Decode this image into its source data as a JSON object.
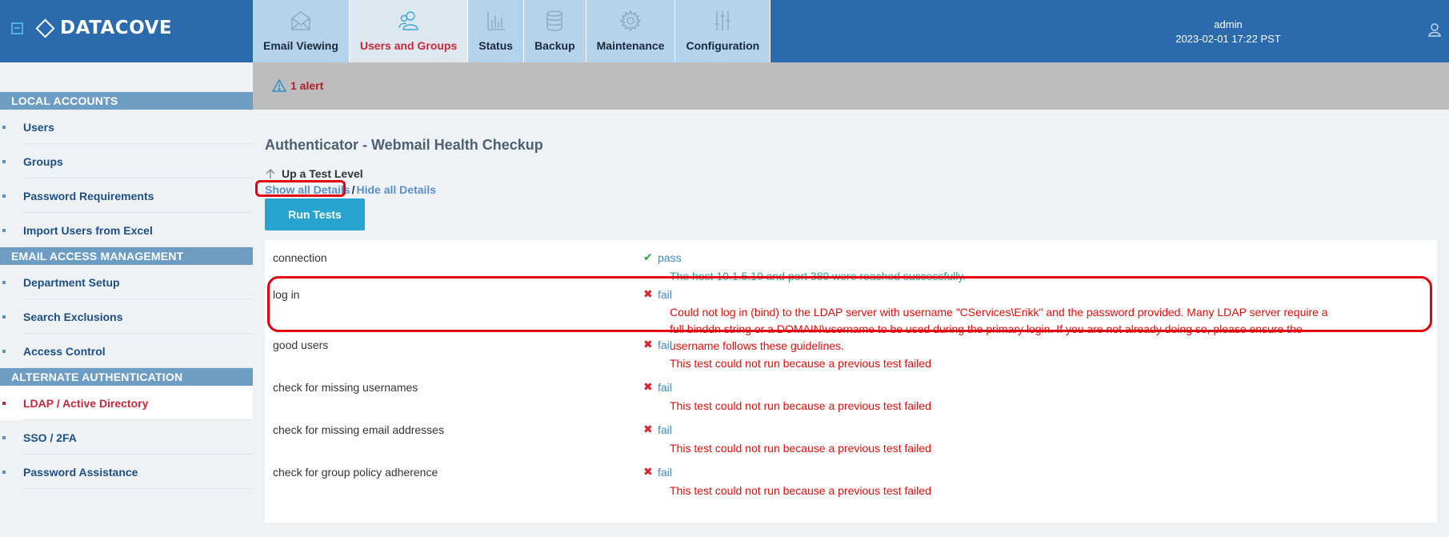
{
  "header": {
    "menu_toggle_icon": "collapse-icon",
    "logo_text": "DATACOVE",
    "tabs": [
      {
        "label": "Email Viewing",
        "icon": "envelope-icon",
        "active": false
      },
      {
        "label": "Users and Groups",
        "icon": "users-icon",
        "active": true
      },
      {
        "label": "Status",
        "icon": "bar-chart-icon",
        "active": false
      },
      {
        "label": "Backup",
        "icon": "database-icon",
        "active": false
      },
      {
        "label": "Maintenance",
        "icon": "gear-icon",
        "active": false
      },
      {
        "label": "Configuration",
        "icon": "sliders-icon",
        "active": false
      }
    ],
    "user": {
      "name": "admin",
      "datetime": "2023-02-01 17:22 PST",
      "icon": "user-icon"
    }
  },
  "sidebar": {
    "sections": [
      {
        "title": "LOCAL ACCOUNTS",
        "items": [
          {
            "label": "Users",
            "active": false
          },
          {
            "label": "Groups",
            "active": false
          },
          {
            "label": "Password Requirements",
            "active": false
          },
          {
            "label": "Import Users from Excel",
            "active": false
          }
        ]
      },
      {
        "title": "EMAIL ACCESS MANAGEMENT",
        "items": [
          {
            "label": "Department Setup",
            "active": false
          },
          {
            "label": "Search Exclusions",
            "active": false
          },
          {
            "label": "Access Control",
            "active": false
          }
        ]
      },
      {
        "title": "ALTERNATE AUTHENTICATION",
        "items": [
          {
            "label": "LDAP / Active Directory",
            "active": true
          },
          {
            "label": "SSO / 2FA",
            "active": false
          },
          {
            "label": "Password Assistance",
            "active": false
          }
        ]
      }
    ]
  },
  "alert": {
    "icon": "warning-icon",
    "text": "1 alert"
  },
  "main": {
    "title": "Authenticator - Webmail Health Checkup",
    "up_level": "Up a Test Level",
    "show_details": "Show all Details",
    "separator": "/",
    "hide_details": "Hide all Details",
    "run_button": "Run Tests",
    "tests": [
      {
        "name": "connection",
        "status": "pass",
        "message": "The host 10.1.5.10 and port 389 were reached successfully."
      },
      {
        "name": "log in",
        "status": "fail",
        "message": "Could not log in (bind) to the LDAP server with username \"CServices\\Erikk\" and the password provided. Many LDAP server require a full binddn string or a DOMAIN\\username to be used during the primary login. If you are not already doing so, please ensure the username follows these guidelines."
      },
      {
        "name": "good users",
        "status": "fail",
        "message": "This test could not run because a previous test failed"
      },
      {
        "name": "check for missing usernames",
        "status": "fail",
        "message": "This test could not run because a previous test failed"
      },
      {
        "name": "check for missing email addresses",
        "status": "fail",
        "message": "This test could not run because a previous test failed"
      },
      {
        "name": "check for group policy adherence",
        "status": "fail",
        "message": "This test could not run because a previous test failed"
      }
    ]
  },
  "colors": {
    "header_bg": "#2a6aad",
    "tab_bg": "#b6d3ec",
    "tab_active_bg": "#dfe7ee",
    "accent_red": "#c8283c",
    "sidebar_header": "#6e9dc4",
    "run_button": "#26a4cf",
    "pass_text": "#29a19c",
    "fail_text": "#e20d0d",
    "annotation_red": "#e20010"
  }
}
